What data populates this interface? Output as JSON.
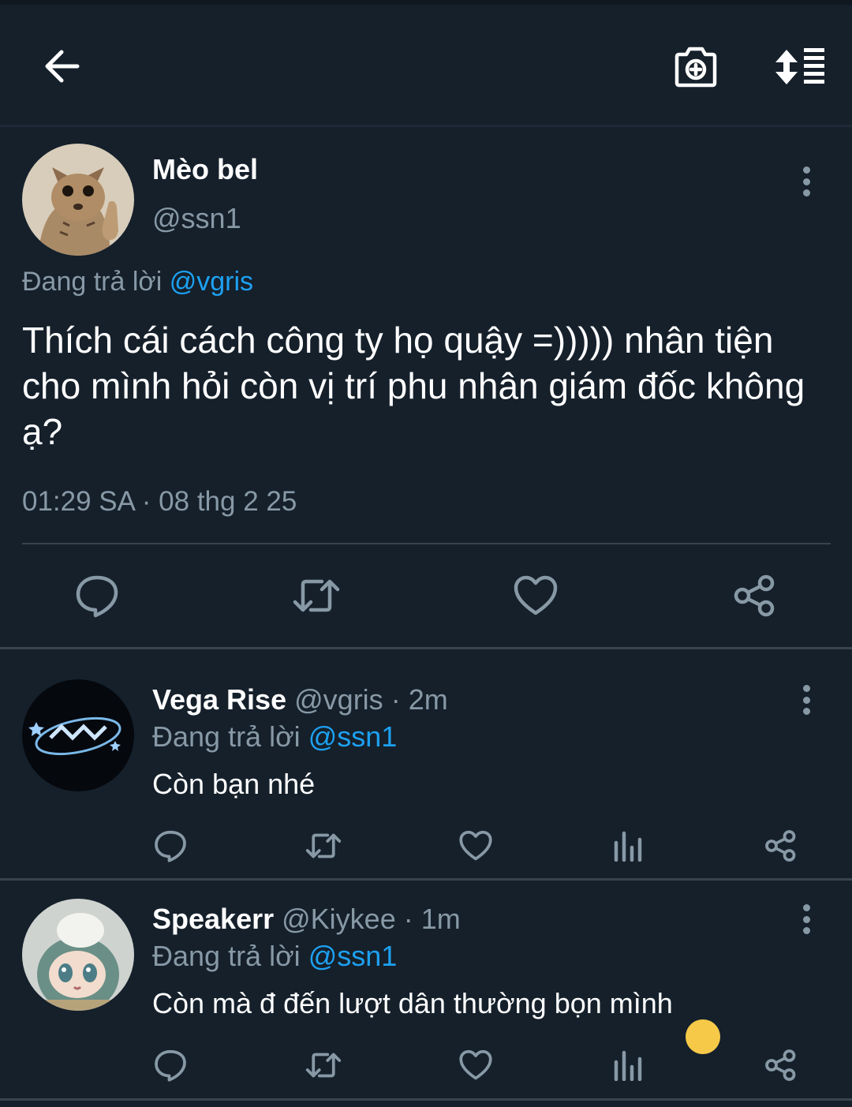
{
  "header": {
    "back_icon": "back-arrow-icon",
    "camera_icon": "camera-plus-icon",
    "sort_icon": "sort-list-icon"
  },
  "main_tweet": {
    "display_name": "Mèo bel",
    "handle": "@ssn1",
    "reply_prefix": "Đang trả lời",
    "reply_to": "@vgris",
    "text": "Thích cái cách công ty họ quậy =))))) nhân tiện cho mình hỏi còn vị trí phu nhân giám đốc không ạ?",
    "timestamp": "01:29 SA · 08 thg 2 25"
  },
  "replies": [
    {
      "display_name": "Vega Rise",
      "handle": "@vgris",
      "sep": "·",
      "time": "2m",
      "reply_prefix": "Đang trả lời",
      "reply_to": "@ssn1",
      "text": "Còn bạn nhé"
    },
    {
      "display_name": "Speakerr",
      "handle": "@Kiykee",
      "sep": "·",
      "time": "1m",
      "reply_prefix": "Đang trả lời",
      "reply_to": "@ssn1",
      "text": "Còn mà đ đến lượt dân thường bọn mình",
      "emoji": "☺️"
    }
  ],
  "colors": {
    "background": "#15202b",
    "muted": "#8899a6",
    "link": "#1da1f2",
    "divider": "#38444d"
  }
}
